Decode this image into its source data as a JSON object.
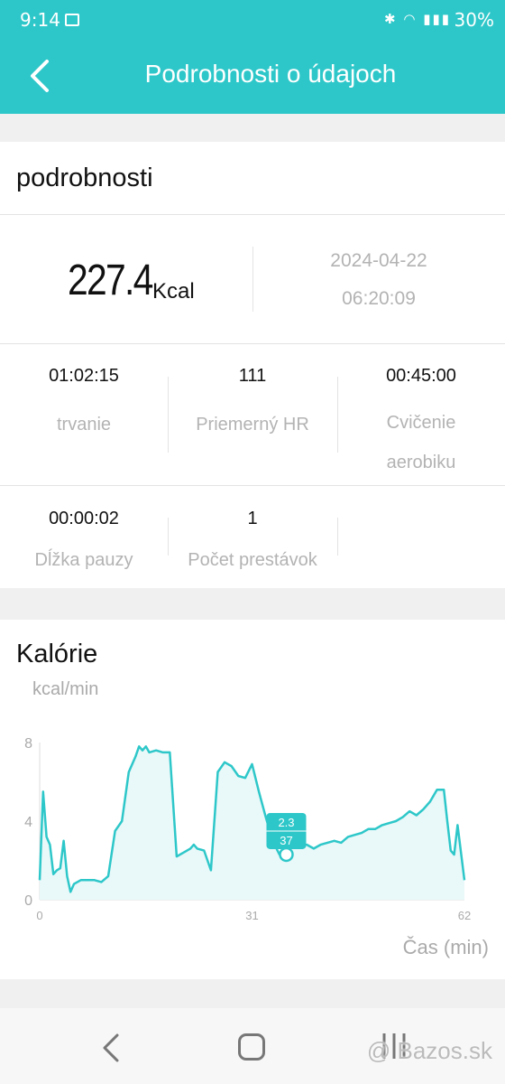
{
  "status": {
    "time": "9:14",
    "battery": "30%"
  },
  "header": {
    "title": "Podrobnosti o údajoch"
  },
  "details": {
    "title": "podrobnosti",
    "calories_value": "227.4",
    "calories_unit": "Kcal",
    "date": "2024-04-22",
    "time": "06:20:09",
    "stats": [
      {
        "value": "01:02:15",
        "label": "trvanie"
      },
      {
        "value": "111",
        "label": "Priemerný HR"
      },
      {
        "value": "00:45:00",
        "label": "Cvičenie aerobiku"
      },
      {
        "value": "00:00:02",
        "label": "Dĺžka pauzy"
      },
      {
        "value": "1",
        "label": "Počet prestávok"
      }
    ]
  },
  "chart_section": {
    "title": "Kalórie",
    "unit_label": "kcal/min",
    "x_axis_label": "Čas (min)"
  },
  "chart_data": {
    "type": "area",
    "ylabel": "kcal/min",
    "xlabel": "Čas (min)",
    "ylim": [
      0,
      8
    ],
    "xlim": [
      0,
      62
    ],
    "y_ticks": [
      "0",
      "4",
      "8"
    ],
    "x_ticks": [
      "0",
      "31",
      "62"
    ],
    "color": "#2ec7c9",
    "x": [
      0,
      0.5,
      1,
      1.5,
      2,
      2.5,
      3,
      3.5,
      4,
      4.5,
      5,
      5.5,
      6,
      7,
      8,
      9,
      10,
      11,
      12,
      13,
      14,
      14.5,
      15,
      15.5,
      16,
      17,
      18,
      19,
      20,
      21,
      22,
      22.5,
      23,
      24,
      25,
      26,
      27,
      28,
      29,
      30,
      31,
      32,
      33,
      34,
      35,
      36,
      37,
      38,
      39,
      40,
      41,
      42,
      43,
      44,
      45,
      46,
      47,
      48,
      49,
      50,
      51,
      52,
      53,
      54,
      55,
      56,
      57,
      58,
      59,
      59.5,
      60,
      60.5,
      61,
      62
    ],
    "values": [
      1.0,
      5.5,
      3.2,
      2.8,
      1.3,
      1.5,
      1.6,
      3.0,
      1.2,
      0.4,
      0.8,
      0.9,
      1.0,
      1.0,
      1.0,
      0.9,
      1.2,
      3.5,
      4.0,
      6.5,
      7.3,
      7.8,
      7.6,
      7.8,
      7.5,
      7.6,
      7.5,
      7.5,
      2.2,
      2.4,
      2.6,
      2.8,
      2.6,
      2.5,
      1.5,
      6.5,
      7.0,
      6.8,
      6.3,
      6.2,
      6.9,
      5.5,
      4.2,
      3.0,
      2.3,
      2.7,
      2.8,
      2.8,
      2.8,
      2.6,
      2.8,
      2.9,
      3.0,
      2.9,
      3.2,
      3.3,
      3.4,
      3.6,
      3.6,
      3.8,
      3.9,
      4.0,
      4.2,
      4.5,
      4.3,
      4.6,
      5.0,
      5.6,
      5.6,
      4.0,
      2.5,
      2.3,
      3.8,
      1.0
    ],
    "tooltip": {
      "x": 36,
      "value": "2.3",
      "label": "37"
    }
  },
  "nav": {
    "watermark": "@ Bazos.sk"
  }
}
